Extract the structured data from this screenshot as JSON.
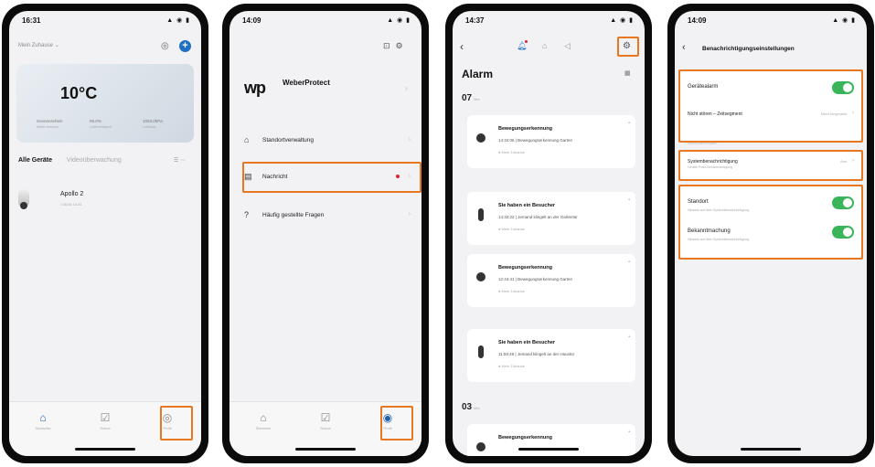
{
  "phone1": {
    "time": "16:31",
    "status_icons": "▲ ◉ ▮",
    "home_selector": "Mein Zuhause ⌄",
    "weather": {
      "temp": "10°C",
      "items": [
        {
          "label": "Sonnenschein",
          "sub": "Wetter draußen"
        },
        {
          "label": "59.0%",
          "sub": "Luftfeuchtigkeit"
        },
        {
          "label": "1003.0hPa",
          "sub": "Luftdruck"
        }
      ]
    },
    "tabs": {
      "all": "Alle Geräte",
      "video": "Videoüberwachung",
      "more": "☰ ⋯"
    },
    "device": {
      "name": "Apollo 2",
      "sub": "• 05.05 14:31"
    },
    "nav": [
      {
        "label": "Startseite"
      },
      {
        "label": "Szene"
      },
      {
        "label": "Profil"
      }
    ]
  },
  "phone2": {
    "time": "14:09",
    "logo": "wp",
    "brand": "WeberProtect",
    "menu": [
      {
        "icon": "⌂",
        "label": "Standortverwaltung"
      },
      {
        "icon": "▤",
        "label": "Nachricht"
      },
      {
        "icon": "?",
        "label": "Häufig gestellte Fragen"
      }
    ],
    "nav": [
      {
        "label": "Startseite"
      },
      {
        "label": "Szene"
      },
      {
        "label": "Profil"
      }
    ]
  },
  "phone3": {
    "time": "14:37",
    "title": "Alarm",
    "day1": {
      "num": "07",
      "month": "Mrz"
    },
    "day2": {
      "num": "03",
      "month": "Mrz"
    },
    "cards": [
      {
        "title": "Bewegungserkennung",
        "desc": "14:34:06 | Bewegungserkennung Garten",
        "loc": "● Mein Zuhause"
      },
      {
        "title": "Sie haben ein Besucher",
        "desc": "14:32:22 | Jemand klingelt an der Gartentür",
        "loc": "● Mein Zuhause"
      },
      {
        "title": "Bewegungserkennung",
        "desc": "12:44:41 | Bewegungserkennung Garten",
        "loc": "● Mein Zuhause"
      },
      {
        "title": "Sie haben ein Besucher",
        "desc": "11:59:48 | Jemand klingelt an der Haustür",
        "loc": "● Mein Zuhause"
      },
      {
        "title": "Bewegungserkennung",
        "desc": "",
        "loc": ""
      }
    ]
  },
  "phone4": {
    "time": "14:09",
    "title": "Benachrichtigungseinstellungen",
    "rows": {
      "device_alarm": {
        "label": "Gerätealarm"
      },
      "dnd": {
        "label": "Nicht stören – Zeitsegment",
        "value": "Nicht eingestellt"
      },
      "section_note": "Nachrichten erhalten",
      "system": {
        "label": "Systembenachrichtigung",
        "sub": "Geräte Push-Benachrichtigung",
        "value": "Aus"
      },
      "location": {
        "label": "Standort",
        "sub": "Hinweis auf über Systembenachrichtigung"
      },
      "announcement": {
        "label": "Bekanntmachung",
        "sub": "Hinweis auf über Systembenachrichtigung"
      }
    }
  },
  "colors": {
    "accent": "#1f6fc4",
    "highlight": "#e87722",
    "toggle": "#3bb55a",
    "badge": "#e0242d"
  }
}
